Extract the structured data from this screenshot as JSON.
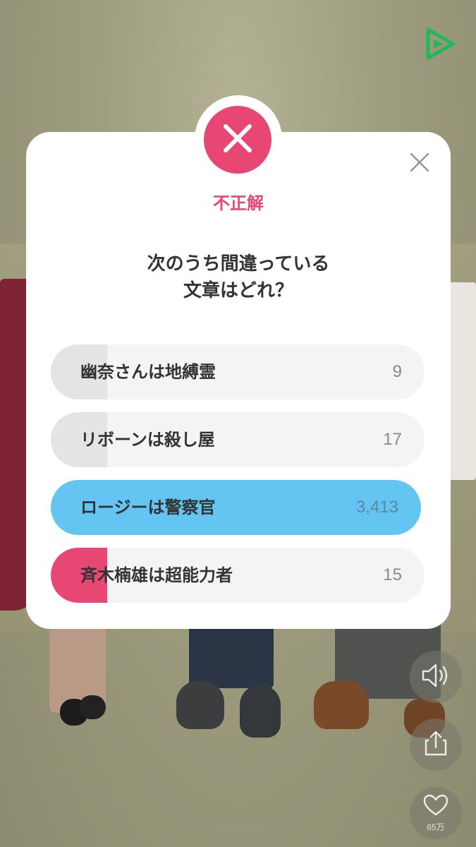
{
  "result": {
    "label": "不正解",
    "accent_color": "#e84774"
  },
  "question": {
    "line1": "次のうち間違っている",
    "line2": "文章はどれ？"
  },
  "options": [
    {
      "label": "幽奈さんは地縛霊",
      "count": "9",
      "state": "other",
      "fill_color": "#e4e4e4"
    },
    {
      "label": "リボーンは殺し屋",
      "count": "17",
      "state": "other",
      "fill_color": "#e4e4e4"
    },
    {
      "label": "ロージーは警察官",
      "count": "3,413",
      "state": "correct",
      "fill_color": "#64c4f2"
    },
    {
      "label": "斉木楠雄は超能力者",
      "count": "15",
      "state": "selected-wrong",
      "fill_color": "#e84774"
    }
  ],
  "side_actions": {
    "like_count": "65万"
  },
  "icons": {
    "badge": "x-mark-icon",
    "close": "close-icon",
    "logo": "play-triangle-icon",
    "sound": "speaker-icon",
    "share": "share-icon",
    "like": "heart-icon"
  }
}
